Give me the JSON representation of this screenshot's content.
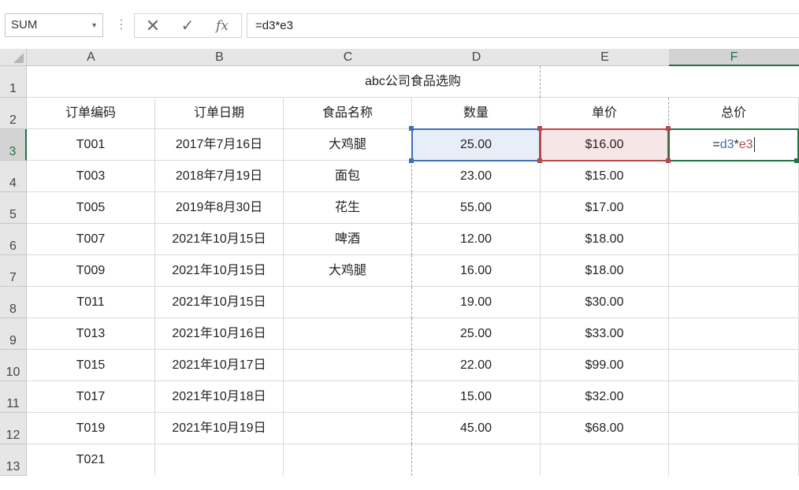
{
  "formula_bar": {
    "name_box": "SUM",
    "name_box_dropdown_icon": "chevron-down-icon",
    "menu_dots_icon": "vertical-dots-icon",
    "cancel_icon": "close-icon",
    "enter_icon": "checkmark-icon",
    "fx_label": "fx",
    "formula": "=d3*e3"
  },
  "grid": {
    "corner_icon": "select-all-triangle-icon",
    "active_column": "F",
    "active_row": "3",
    "columns": [
      "A",
      "B",
      "C",
      "D",
      "E",
      "F"
    ],
    "rows": [
      "1",
      "2",
      "3",
      "4",
      "5",
      "6",
      "7",
      "8",
      "9",
      "10",
      "11",
      "12",
      "13"
    ],
    "title": "abc公司食品选购",
    "headers": [
      "订单编码",
      "订单日期",
      "食品名称",
      "数量",
      "单价",
      "总价"
    ],
    "data": [
      [
        "T001",
        "2017年7月16日",
        "大鸡腿",
        "25.00",
        "$16.00",
        ""
      ],
      [
        "T003",
        "2018年7月19日",
        "面包",
        "23.00",
        "$15.00",
        ""
      ],
      [
        "T005",
        "2019年8月30日",
        "花生",
        "55.00",
        "$17.00",
        ""
      ],
      [
        "T007",
        "2021年10月15日",
        "啤酒",
        "12.00",
        "$18.00",
        ""
      ],
      [
        "T009",
        "2021年10月15日",
        "大鸡腿",
        "16.00",
        "$18.00",
        ""
      ],
      [
        "T011",
        "2021年10月15日",
        "",
        "19.00",
        "$30.00",
        ""
      ],
      [
        "T013",
        "2021年10月16日",
        "",
        "25.00",
        "$33.00",
        ""
      ],
      [
        "T015",
        "2021年10月17日",
        "",
        "22.00",
        "$99.00",
        ""
      ],
      [
        "T017",
        "2021年10月18日",
        "",
        "15.00",
        "$32.00",
        ""
      ],
      [
        "T019",
        "2021年10月19日",
        "",
        "45.00",
        "$68.00",
        ""
      ],
      [
        "T021",
        "",
        "",
        "",
        "",
        ""
      ]
    ],
    "editing_cell": {
      "address": "F3",
      "tokens": [
        {
          "text": "=",
          "kind": "eq"
        },
        {
          "text": "d3",
          "kind": "d"
        },
        {
          "text": "*",
          "kind": "op"
        },
        {
          "text": "e3",
          "kind": "e"
        }
      ]
    }
  },
  "colors": {
    "accent_green": "#217346",
    "ref_blue": "#3f6fb5",
    "ref_red": "#b64a4a",
    "header_bg": "#e6e6e6"
  }
}
